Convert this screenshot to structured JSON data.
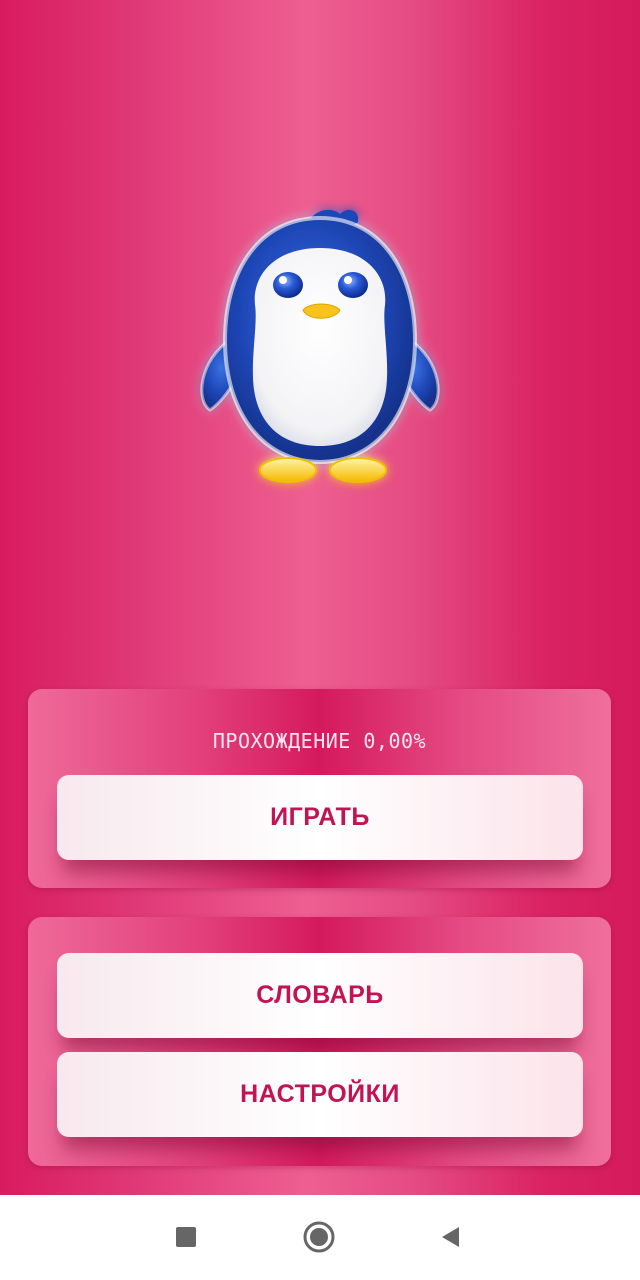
{
  "colors": {
    "accent": "#c21352",
    "background": "#e03a78",
    "panel": "#d41a5d",
    "button": "#ffffff",
    "navbar": "#ffffff",
    "nav_icon": "#666666"
  },
  "mascot": {
    "icon": "penguin-icon"
  },
  "progress": {
    "label": "ПРОХОЖДЕНИЕ 0,00%",
    "value_percent": 0.0
  },
  "buttons": {
    "play": "ИГРАТЬ",
    "dictionary": "СЛОВАРЬ",
    "settings": "НАСТРОЙКИ"
  },
  "navbar": {
    "recents_icon": "square-icon",
    "home_icon": "circle-icon",
    "back_icon": "triangle-back-icon"
  }
}
